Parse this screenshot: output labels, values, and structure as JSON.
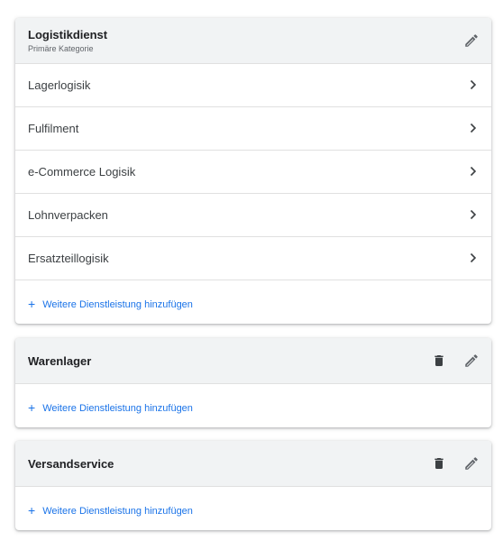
{
  "cards": [
    {
      "title": "Logistikdienst",
      "subtitle": "Primäre Kategorie",
      "items": [
        {
          "label": "Lagerlogisik"
        },
        {
          "label": "Fulfilment"
        },
        {
          "label": "e-Commerce Logisik"
        },
        {
          "label": "Lohnverpacken"
        },
        {
          "label": "Ersatzteillogisik"
        }
      ],
      "add_label": "Weitere Dienstleistung hinzufügen"
    },
    {
      "title": "Warenlager",
      "add_label": "Weitere Dienstleistung hinzufügen"
    },
    {
      "title": "Versandservice",
      "add_label": "Weitere Dienstleistung hinzufügen"
    }
  ],
  "icons": {
    "plus": "+",
    "edit": "pencil-icon",
    "delete": "trash-icon",
    "chevron": "chevron-right-icon"
  },
  "colors": {
    "accent": "#1a73e8",
    "header_bg": "#f1f3f4",
    "icon": "#5f6368"
  }
}
